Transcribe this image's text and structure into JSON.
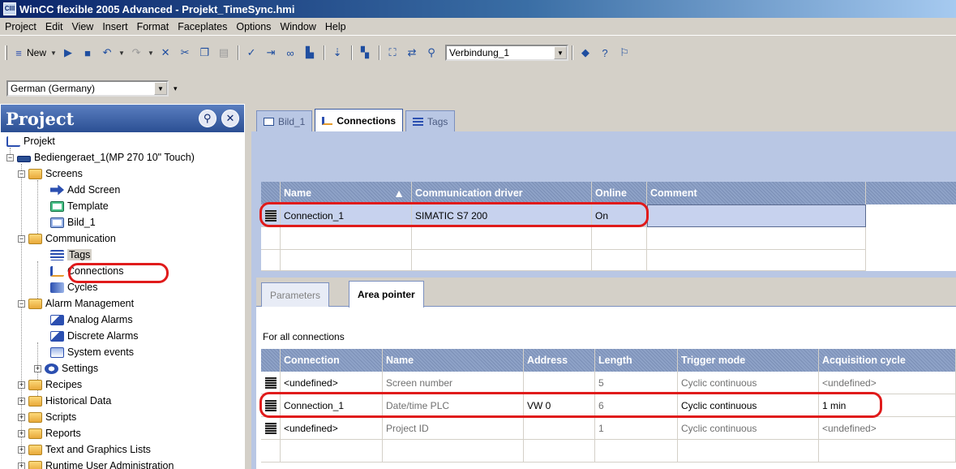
{
  "window": {
    "title": "WinCC flexible 2005 Advanced - Projekt_TimeSync.hmi"
  },
  "menu": [
    "Project",
    "Edit",
    "View",
    "Insert",
    "Format",
    "Faceplates",
    "Options",
    "Window",
    "Help"
  ],
  "toolbar": {
    "new_label": "New",
    "connection_combo": "Verbindung_1",
    "language_combo": "German (Germany)"
  },
  "project_panel": {
    "title": "Project",
    "tree": {
      "root": "Projekt",
      "device": "Bediengeraet_1(MP 270 10\" Touch)",
      "screens": "Screens",
      "add_screen": "Add Screen",
      "template": "Template",
      "bild1": "Bild_1",
      "communication": "Communication",
      "tags": "Tags",
      "connections": "Connections",
      "cycles": "Cycles",
      "alarm_mgmt": "Alarm Management",
      "analog_alarms": "Analog Alarms",
      "discrete_alarms": "Discrete Alarms",
      "system_events": "System events",
      "settings": "Settings",
      "recipes": "Recipes",
      "historical": "Historical Data",
      "scripts": "Scripts",
      "reports": "Reports",
      "text_graphics": "Text and Graphics Lists",
      "runtime_user": "Runtime User Administration"
    }
  },
  "editor_tabs": [
    "Bild_1",
    "Connections",
    "Tags"
  ],
  "connections_table": {
    "headers": [
      "Name",
      "Communication driver",
      "Online",
      "Comment"
    ],
    "rows": [
      {
        "name": "Connection_1",
        "driver": "SIMATIC S7 200",
        "online": "On",
        "comment": ""
      }
    ]
  },
  "sub_tabs": [
    "Parameters",
    "Area pointer"
  ],
  "area_pointer": {
    "caption": "For all connections",
    "headers": [
      "Connection",
      "Name",
      "Address",
      "Length",
      "Trigger mode",
      "Acquisition cycle"
    ],
    "rows": [
      {
        "connection": "<undefined>",
        "name": "Screen number",
        "address": "",
        "length": "5",
        "trigger": "Cyclic continuous",
        "cycle": "<undefined>"
      },
      {
        "connection": "Connection_1",
        "name": "Date/time PLC",
        "address": "VW 0",
        "length": "6",
        "trigger": "Cyclic continuous",
        "cycle": "1 min"
      },
      {
        "connection": "<undefined>",
        "name": "Project ID",
        "address": "",
        "length": "1",
        "trigger": "Cyclic continuous",
        "cycle": "<undefined>"
      }
    ]
  },
  "colors": {
    "highlight_oval": "#e01b1b",
    "panel_header": "#2b4f93",
    "editor_bg": "#b9c7e4"
  }
}
